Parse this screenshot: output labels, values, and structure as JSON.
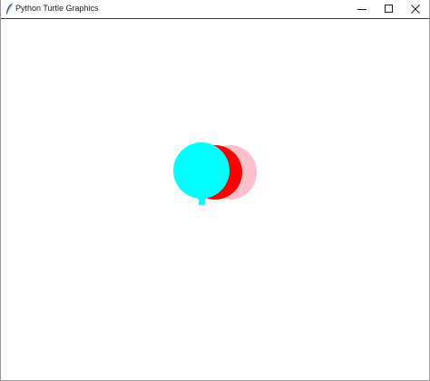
{
  "window": {
    "title": "Python Turtle Graphics",
    "app_icon": "feather-icon",
    "controls": {
      "minimize_icon": "minimize-icon",
      "maximize_icon": "maximize-icon",
      "close_icon": "close-icon"
    }
  },
  "canvas": {
    "background": "#ffffff",
    "shapes": [
      {
        "name": "pink-circle",
        "color": "#ffc0cb"
      },
      {
        "name": "red-circle",
        "color": "#ff0000"
      },
      {
        "name": "cyan-balloon",
        "color": "#00ffff"
      }
    ]
  }
}
